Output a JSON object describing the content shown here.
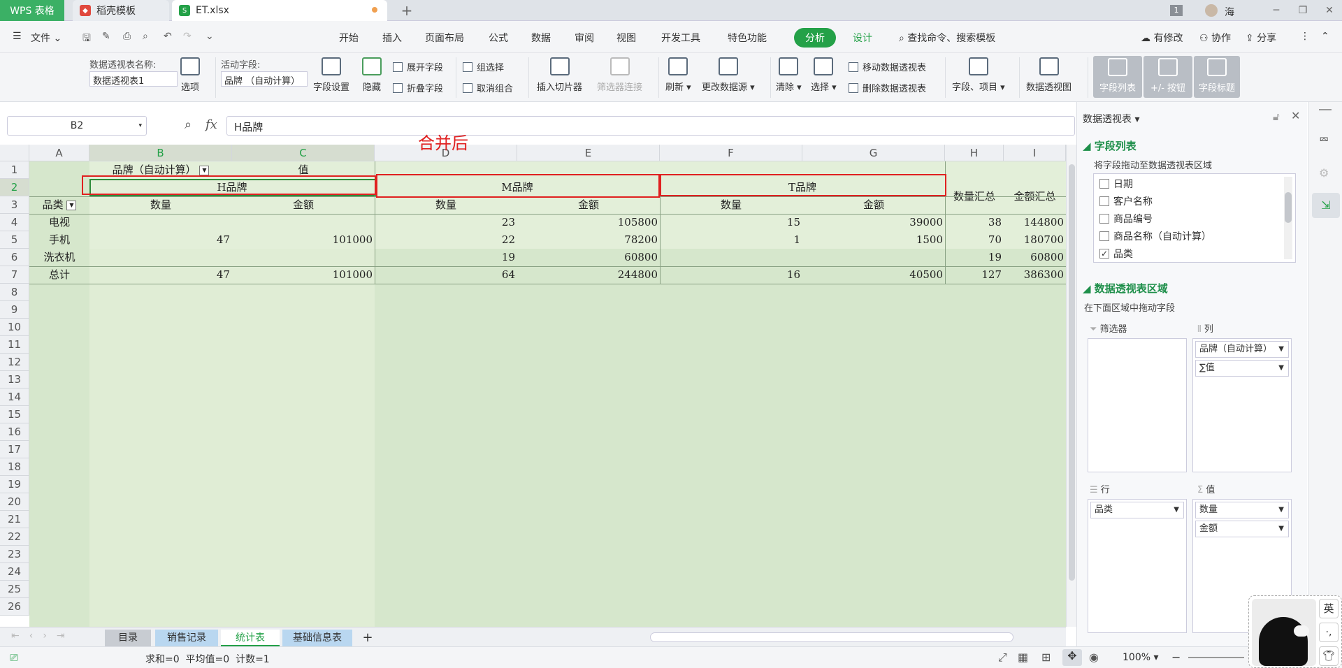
{
  "titlebar": {
    "app_tab": "WPS 表格",
    "tab2": "稻壳模板",
    "tab3": "ET.xlsx",
    "add": "+",
    "badge": "1",
    "user": "海"
  },
  "menubar": {
    "file": "文件",
    "items": [
      "开始",
      "插入",
      "页面布局",
      "公式",
      "数据",
      "审阅",
      "视图",
      "开发工具",
      "特色功能",
      "分析",
      "设计"
    ],
    "search": "查找命令、搜索模板",
    "modified": "有修改",
    "collab": "协作",
    "share": "分享"
  },
  "ribbon": {
    "pivot_name_label": "数据透视表名称:",
    "pivot_name_value": "数据透视表1",
    "options": "选项",
    "active_field_label": "活动字段:",
    "active_field_value": "品牌 （自动计算）",
    "field_settings": "字段设置",
    "hide": "隐藏",
    "expand": "展开字段",
    "collapse": "折叠字段",
    "group_select": "组选择",
    "ungroup": "取消组合",
    "insert_slicer": "插入切片器",
    "filter_conn": "筛选器连接",
    "refresh": "刷新",
    "change_source": "更改数据源",
    "clear": "清除",
    "select": "选择",
    "move_pivot": "移动数据透视表",
    "delete_pivot": "删除数据透视表",
    "fields_items": "字段、项目",
    "pivot_chart": "数据透视图",
    "field_list": "字段列表",
    "pm_buttons": "+/- 按钮",
    "field_headers": "字段标题"
  },
  "formula": {
    "cell_ref": "B2",
    "fx": "fx",
    "content": "H品牌"
  },
  "annotation": "合并后",
  "grid": {
    "columns": [
      "A",
      "B",
      "C",
      "D",
      "E",
      "F",
      "G",
      "H",
      "I"
    ],
    "rows": [
      "1",
      "2",
      "3",
      "4",
      "5",
      "6",
      "7",
      "8",
      "9",
      "10",
      "11",
      "12",
      "13",
      "14",
      "15",
      "16",
      "17",
      "18",
      "19",
      "20",
      "21",
      "22",
      "23",
      "24",
      "25",
      "26"
    ],
    "r1": {
      "b": "品牌（自动计算）",
      "c": "值"
    },
    "r2": {
      "b": "H品牌",
      "d": "M品牌",
      "f": "T品牌",
      "h": "数量汇总",
      "i": "金额汇总"
    },
    "r3": {
      "a": "品类",
      "b": "数量",
      "c": "金额",
      "d": "数量",
      "e": "金额",
      "f": "数量",
      "g": "金额"
    },
    "data": [
      {
        "a": "电视",
        "b": "",
        "c": "",
        "d": "23",
        "e": "105800",
        "f": "15",
        "g": "39000",
        "h": "38",
        "i": "144800"
      },
      {
        "a": "手机",
        "b": "47",
        "c": "101000",
        "d": "22",
        "e": "78200",
        "f": "1",
        "g": "1500",
        "h": "70",
        "i": "180700"
      },
      {
        "a": "洗衣机",
        "b": "",
        "c": "",
        "d": "19",
        "e": "60800",
        "f": "",
        "g": "",
        "h": "19",
        "i": "60800"
      },
      {
        "a": "总计",
        "b": "47",
        "c": "101000",
        "d": "64",
        "e": "244800",
        "f": "16",
        "g": "40500",
        "h": "127",
        "i": "386300"
      }
    ]
  },
  "sheets": {
    "items": [
      "目录",
      "销售记录",
      "统计表",
      "基础信息表"
    ],
    "active": "统计表",
    "add": "+"
  },
  "status": {
    "summary": "求和=0  平均值=0  计数=1",
    "zoom": "100%"
  },
  "pane": {
    "title": "数据透视表",
    "field_list_title": "字段列表",
    "field_hint": "将字段拖动至数据透视表区域",
    "fields": [
      {
        "label": "日期",
        "checked": false
      },
      {
        "label": "客户名称",
        "checked": false
      },
      {
        "label": "商品编号",
        "checked": false
      },
      {
        "label": "商品名称（自动计算）",
        "checked": false
      },
      {
        "label": "品类",
        "checked": true
      }
    ],
    "areas_title": "数据透视表区域",
    "areas_hint": "在下面区域中拖动字段",
    "filter_label": "筛选器",
    "column_label": "列",
    "row_label": "行",
    "value_label": "值",
    "column_items": [
      "品牌（自动计算）",
      "∑值"
    ],
    "row_items": [
      "品类"
    ],
    "value_items": [
      "数量",
      "金额"
    ]
  },
  "ime": {
    "key": "英"
  },
  "colors": {
    "brand_green": "#24a148",
    "pivot_fill": "#dcebd3",
    "annotation_red": "#e02020"
  }
}
